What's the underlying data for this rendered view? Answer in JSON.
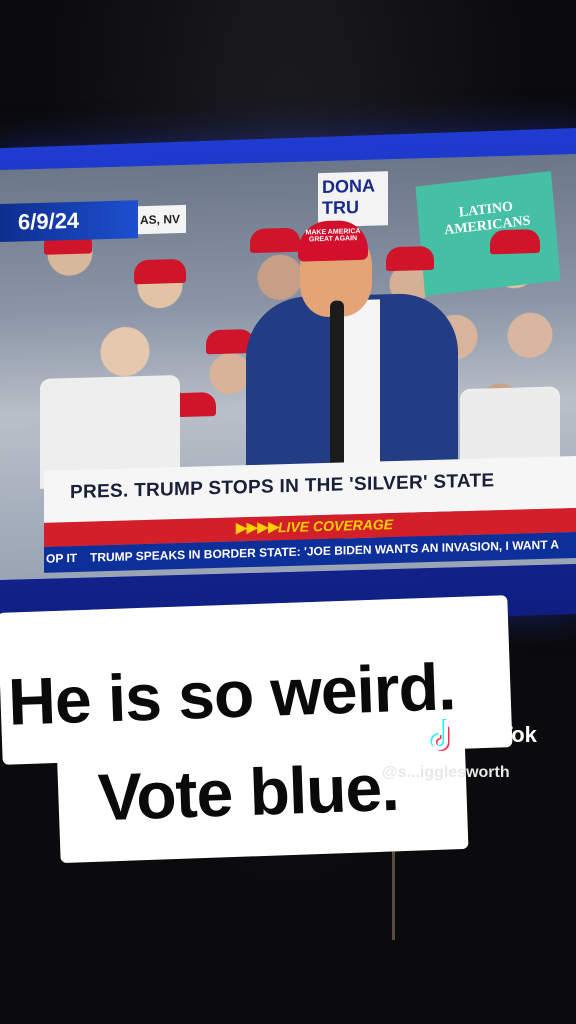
{
  "tv": {
    "date": "6/9/24",
    "location": "AS, NV",
    "headline": "PRES. TRUMP STOPS IN THE 'SILVER' STATE",
    "live_label": "LIVE COVERAGE",
    "live_arrows": "▶▶▶▶",
    "ticker_left": "OP IT",
    "ticker_main": "TRUMP SPEAKS IN BORDER STATE: 'JOE BIDEN WANTS AN INVASION, I WANT A",
    "sign_green_text": "LATINO AMERICANS",
    "sign_white_text": "DONA TRU",
    "hat_text": "MAKE AMERICA GREAT AGAIN"
  },
  "caption": {
    "line1": "He is so weird.",
    "line2": "Vote blue."
  },
  "watermark": {
    "brand": "TikTok",
    "username": "@s...igglesworth"
  },
  "colors": {
    "tv_blue": "#1f3bd0",
    "headline_red": "#d21f2a",
    "ticker_blue": "#0c2f9a",
    "live_yellow": "#ffd000"
  }
}
